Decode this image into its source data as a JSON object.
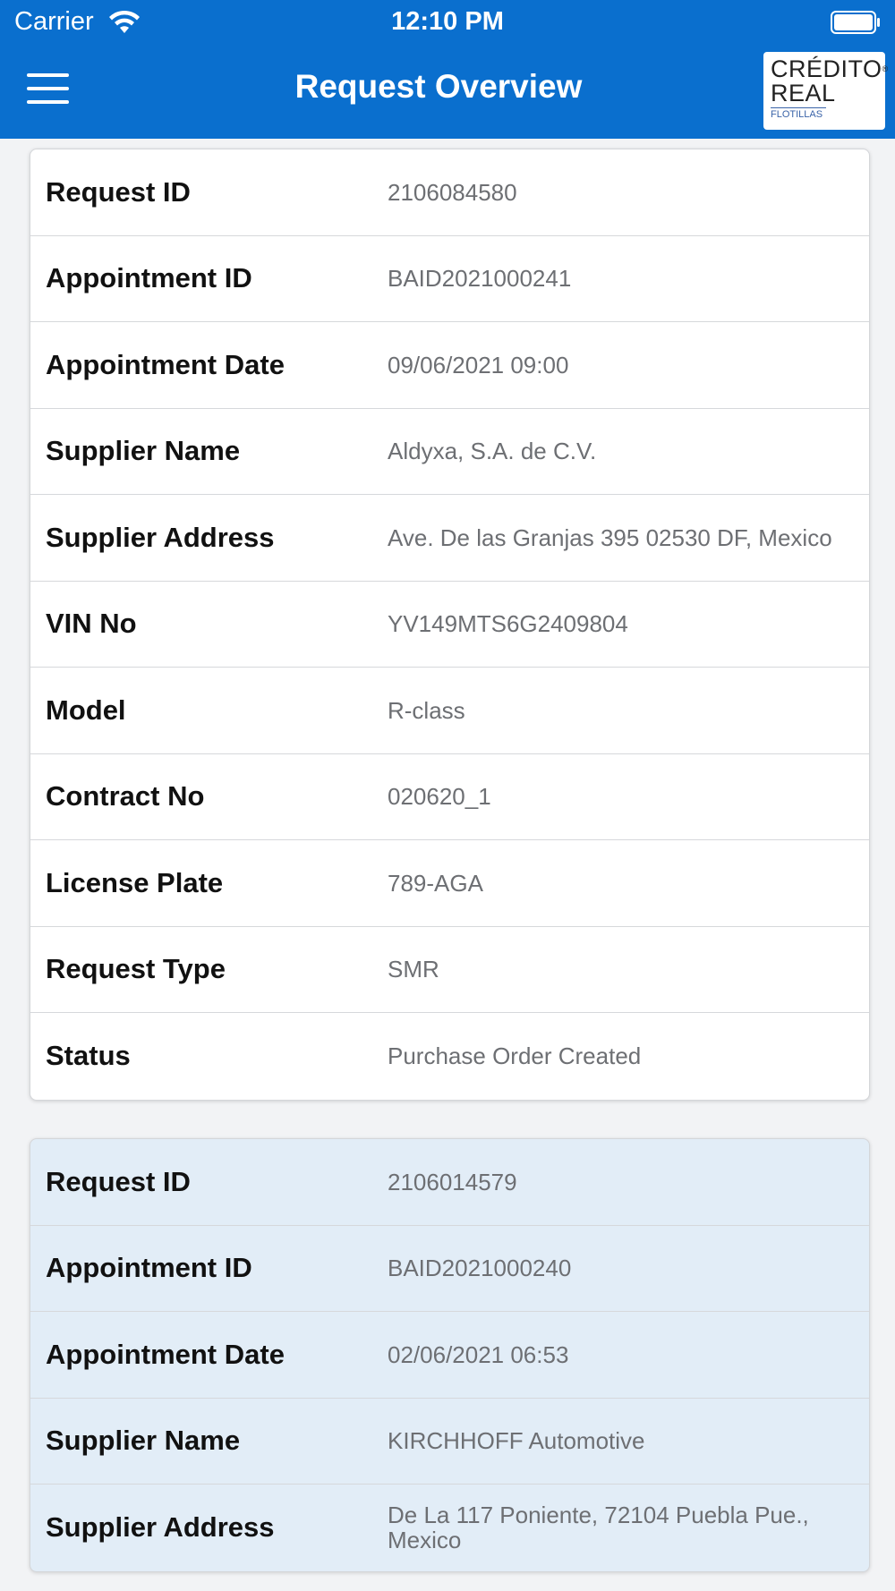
{
  "status_bar": {
    "carrier": "Carrier",
    "time": "12:10 PM"
  },
  "header": {
    "title": "Request Overview",
    "logo": {
      "line1": "CRÉDITO",
      "line2": "REAL",
      "line3": "FLOTILLAS"
    }
  },
  "icons": {
    "menu": "hamburger-menu-icon",
    "wifi": "wifi-icon",
    "battery": "battery-icon"
  },
  "colors": {
    "header_bg": "#0a6fce",
    "alt_card_bg": "#e2edf7"
  },
  "requests": [
    {
      "fields": [
        {
          "label": "Request ID",
          "value": "2106084580"
        },
        {
          "label": "Appointment ID",
          "value": "BAID2021000241"
        },
        {
          "label": "Appointment Date",
          "value": "09/06/2021 09:00"
        },
        {
          "label": "Supplier Name",
          "value": "Aldyxa, S.A. de C.V."
        },
        {
          "label": "Supplier Address",
          "value": "Ave. De las Granjas 395 02530 DF, Mexico"
        },
        {
          "label": "VIN No",
          "value": "YV149MTS6G2409804"
        },
        {
          "label": "Model",
          "value": "R-class"
        },
        {
          "label": "Contract No",
          "value": "020620_1"
        },
        {
          "label": "License Plate",
          "value": "789-AGA"
        },
        {
          "label": "Request Type",
          "value": "SMR"
        },
        {
          "label": "Status",
          "value": "Purchase Order Created"
        }
      ]
    },
    {
      "fields": [
        {
          "label": "Request ID",
          "value": "2106014579"
        },
        {
          "label": "Appointment ID",
          "value": "BAID2021000240"
        },
        {
          "label": "Appointment Date",
          "value": "02/06/2021 06:53"
        },
        {
          "label": "Supplier Name",
          "value": "KIRCHHOFF Automotive"
        },
        {
          "label": "Supplier Address",
          "value": "De La 117 Poniente, 72104 Puebla Pue., Mexico"
        }
      ]
    }
  ]
}
